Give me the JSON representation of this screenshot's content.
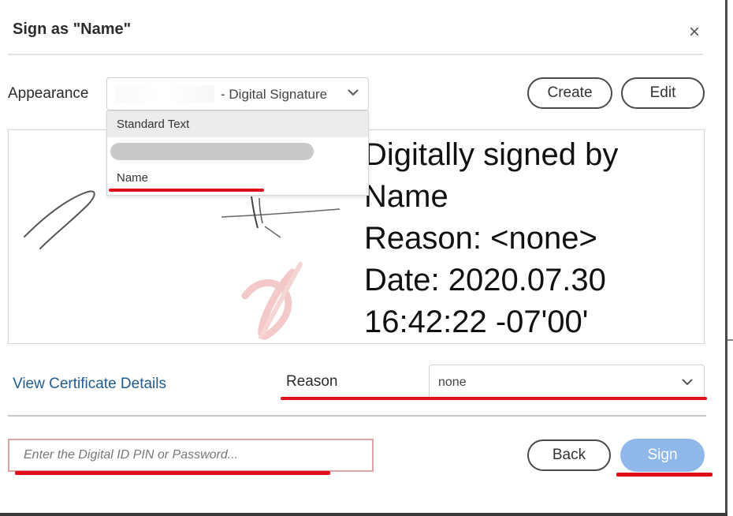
{
  "dialog": {
    "title": "Sign as \"Name\"",
    "close_glyph": "×"
  },
  "appearance": {
    "label": "Appearance",
    "selected": "- Digital Signature",
    "options": [
      "Standard Text",
      "Name"
    ],
    "create_label": "Create",
    "edit_label": "Edit"
  },
  "preview": {
    "lines": [
      "Digitally signed by",
      "Name",
      "Reason: <none>",
      "Date: 2020.07.30",
      "16:42:22 -07'00'"
    ]
  },
  "certificate": {
    "link_label": "View Certificate Details"
  },
  "reason": {
    "label": "Reason",
    "value": "none"
  },
  "pin": {
    "placeholder": "Enter the Digital ID PIN or Password..."
  },
  "actions": {
    "back_label": "Back",
    "sign_label": "Sign"
  },
  "icons": {
    "close": "close-icon",
    "dropdown": "chevron-down-icon",
    "watermark": "acrobat-watermark"
  },
  "colors": {
    "sign_button": "#8fb8e8",
    "link": "#1f5c8f",
    "annotation_red": "#e0101a",
    "pin_border": "#e2a3a6"
  }
}
